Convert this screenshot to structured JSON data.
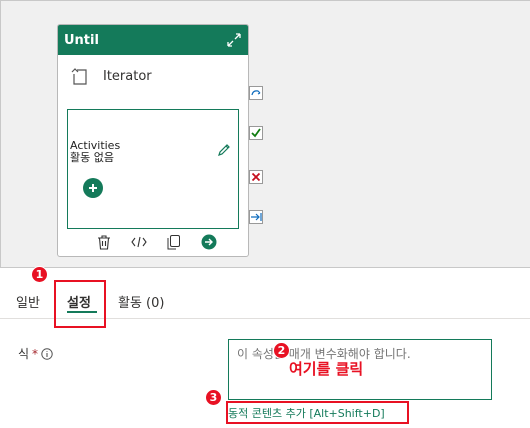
{
  "until_card": {
    "title": "Until",
    "iterator_label": "Iterator",
    "activities_title": "Activities",
    "activities_empty": "활동 없음"
  },
  "tabs": {
    "general": "일반",
    "settings": "설정",
    "activities": "활동 (0)"
  },
  "expression": {
    "label": "식",
    "required_mark": "*",
    "placeholder": "이 속성은 매개 변수화해야 합니다.",
    "dynamic_content_link": "동적 콘텐츠 추가 [Alt+Shift+D]"
  },
  "annotations": {
    "badge1": "1",
    "badge2": "2",
    "badge3": "3",
    "click_here": "여기를 클릭"
  },
  "colors": {
    "accent": "#147a5a",
    "annotation": "#e81123"
  }
}
